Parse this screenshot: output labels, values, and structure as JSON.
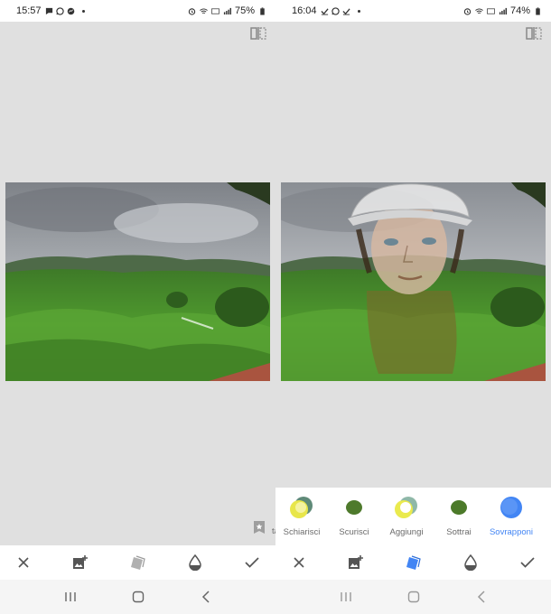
{
  "left": {
    "status": {
      "time": "15:57",
      "battery": "75%"
    },
    "blend_label_cut": "ta"
  },
  "right": {
    "status": {
      "time": "16:04",
      "battery": "74%"
    },
    "blend_modes": [
      {
        "label": "Schiarisci",
        "active": false
      },
      {
        "label": "Scurisci",
        "active": false
      },
      {
        "label": "Aggiungi",
        "active": false
      },
      {
        "label": "Sottrai",
        "active": false
      },
      {
        "label": "Sovrapponi",
        "active": true
      }
    ]
  },
  "colors": {
    "accent": "#4285f4",
    "background": "#e0e0e0",
    "toolbar_icon": "#555555"
  },
  "icons": {
    "status_left": [
      "message-icon",
      "whatsapp-icon",
      "messenger-icon"
    ],
    "status_right": [
      "alarm-icon",
      "wifi-icon",
      "volte-icon",
      "signal-icon",
      "battery-icon"
    ],
    "toolbar": [
      "close-icon",
      "add-image-icon",
      "blend-mode-icon",
      "opacity-icon",
      "check-icon"
    ],
    "navbar": [
      "recents-icon",
      "home-icon",
      "back-icon"
    ]
  }
}
